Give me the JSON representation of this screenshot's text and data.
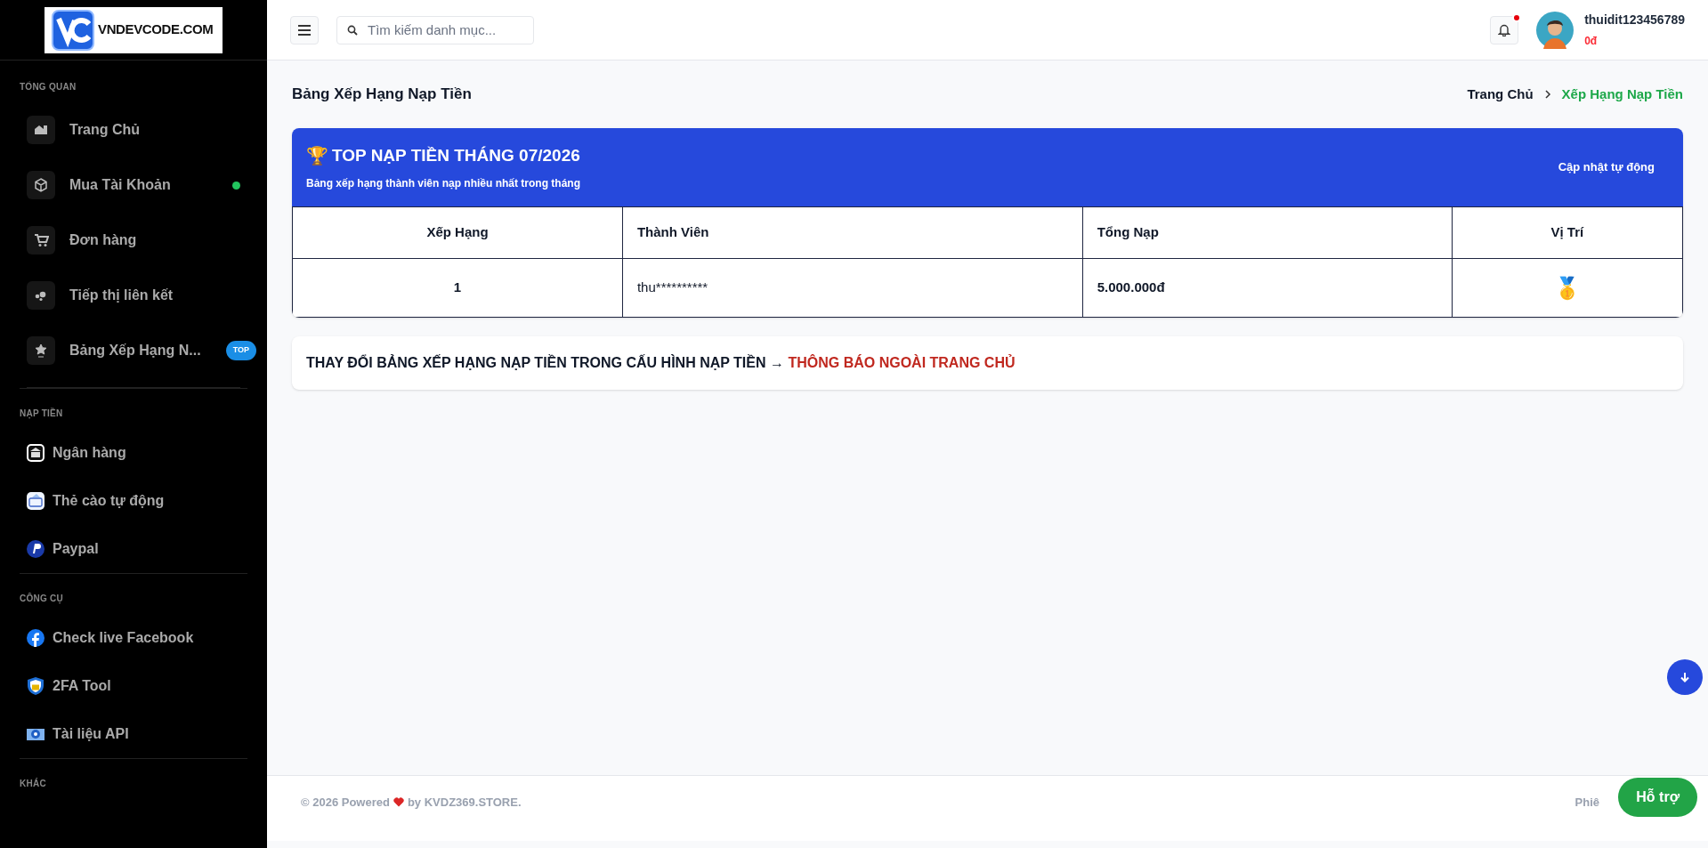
{
  "logo": {
    "text": "VNDEVCODE.COM"
  },
  "sidebar": {
    "sections": [
      {
        "title": "TỔNG QUAN",
        "items": [
          {
            "label": "Trang Chủ"
          },
          {
            "label": "Mua Tài Khoản",
            "color": "#22c55e"
          },
          {
            "label": "Đơn hàng"
          },
          {
            "label": "Tiếp thị liên kết"
          },
          {
            "label": "Bảng Xếp Hạng N...",
            "badge": "TOP"
          }
        ]
      },
      {
        "title": "NẠP TIỀN",
        "items": [
          {
            "label": "Ngân hàng"
          },
          {
            "label": "Thẻ cào tự động"
          },
          {
            "label": "Paypal"
          }
        ]
      },
      {
        "title": "CÔNG CỤ",
        "items": [
          {
            "label": "Check live Facebook"
          },
          {
            "label": "2FA Tool"
          },
          {
            "label": "Tài liệu API"
          }
        ]
      },
      {
        "title": "KHÁC"
      }
    ]
  },
  "header": {
    "search": {
      "placeholder": "Tìm kiếm danh mục..."
    },
    "notification_dot": true,
    "user": {
      "name": "thuidit123456789",
      "balance": "0đ"
    }
  },
  "page": {
    "title": "Bảng Xếp Hạng Nạp Tiền",
    "breadcrumb": [
      {
        "label": "Trang Chủ",
        "selected": false
      },
      {
        "label": "Xếp Hạng Nạp Tiền",
        "selected": true
      }
    ]
  },
  "ranking": {
    "icon": "🏆",
    "title": "TOP NẠP TIỀN THÁNG 07/2026",
    "subtitle": "Bảng xếp hạng thành viên nạp nhiều nhất trong tháng",
    "note": "Cập nhật tự động",
    "columns": [
      "Xếp Hạng",
      "Thành Viên",
      "Tổng Nạp",
      "Vị Trí"
    ],
    "rows": [
      {
        "rank": "1",
        "member": "thu**********",
        "total": "5.000.000đ",
        "medal": "🥇"
      }
    ]
  },
  "notice": {
    "text": "THAY ĐỔI BẢNG XẾP HẠNG NẠP TIỀN TRONG CẤU HÌNH NẠP TIỀN →",
    "link": "THÔNG BÁO NGOÀI TRANG CHỦ"
  },
  "footer": {
    "prefix": "© 2026 Powered",
    "suffix": "by KVDZ369.STORE.",
    "right": "Phiê"
  },
  "support_button": "Hỗ trợ"
}
